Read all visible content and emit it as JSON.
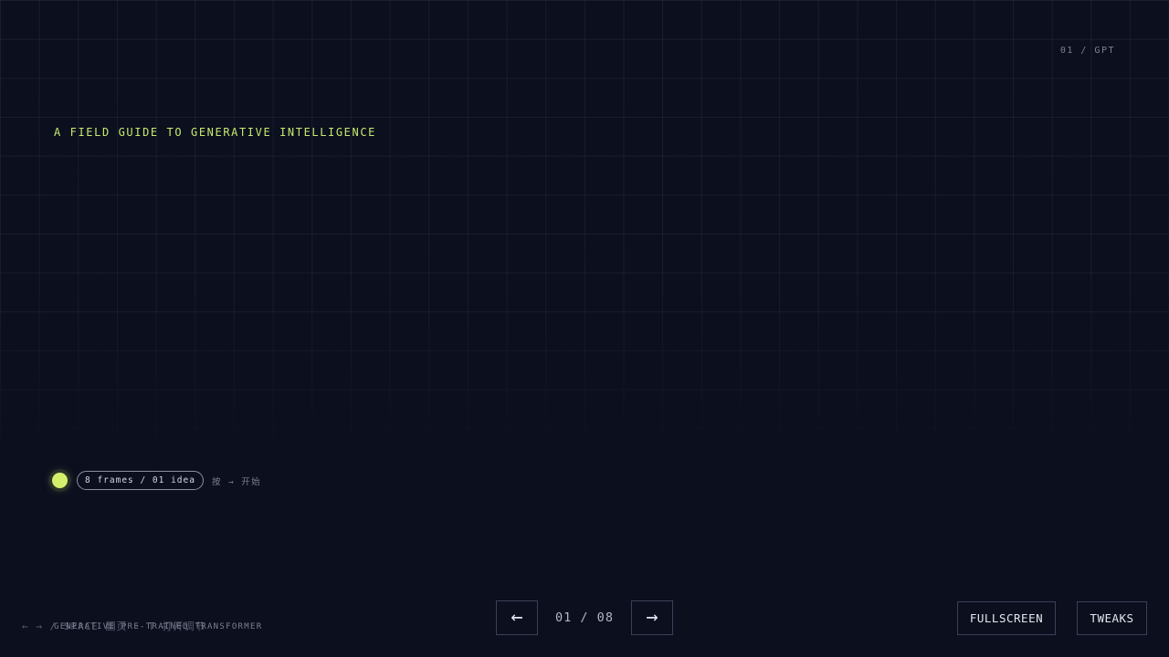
{
  "header": {
    "slide_label": "01 / GPT",
    "kicker": "A FIELD GUIDE TO GENERATIVE INTELLIGENCE"
  },
  "status": {
    "pill": "8 frames / 01 idea",
    "hint": "按 → 开始",
    "dot_color": "#d4f06b"
  },
  "footer": {
    "keys_hint": "← → / SPACE 翻页 · T 打开调节",
    "caption": "GENERATIVE PRE-TRAINED TRANSFORMER"
  },
  "nav": {
    "prev_icon": "←",
    "next_icon": "→",
    "counter": "01 / 08"
  },
  "controls": {
    "fullscreen_label": "FULLSCREEN",
    "tweaks_label": "TWEAKS"
  },
  "colors": {
    "background": "#0b0f1e",
    "accent": "#c8ea6e"
  }
}
